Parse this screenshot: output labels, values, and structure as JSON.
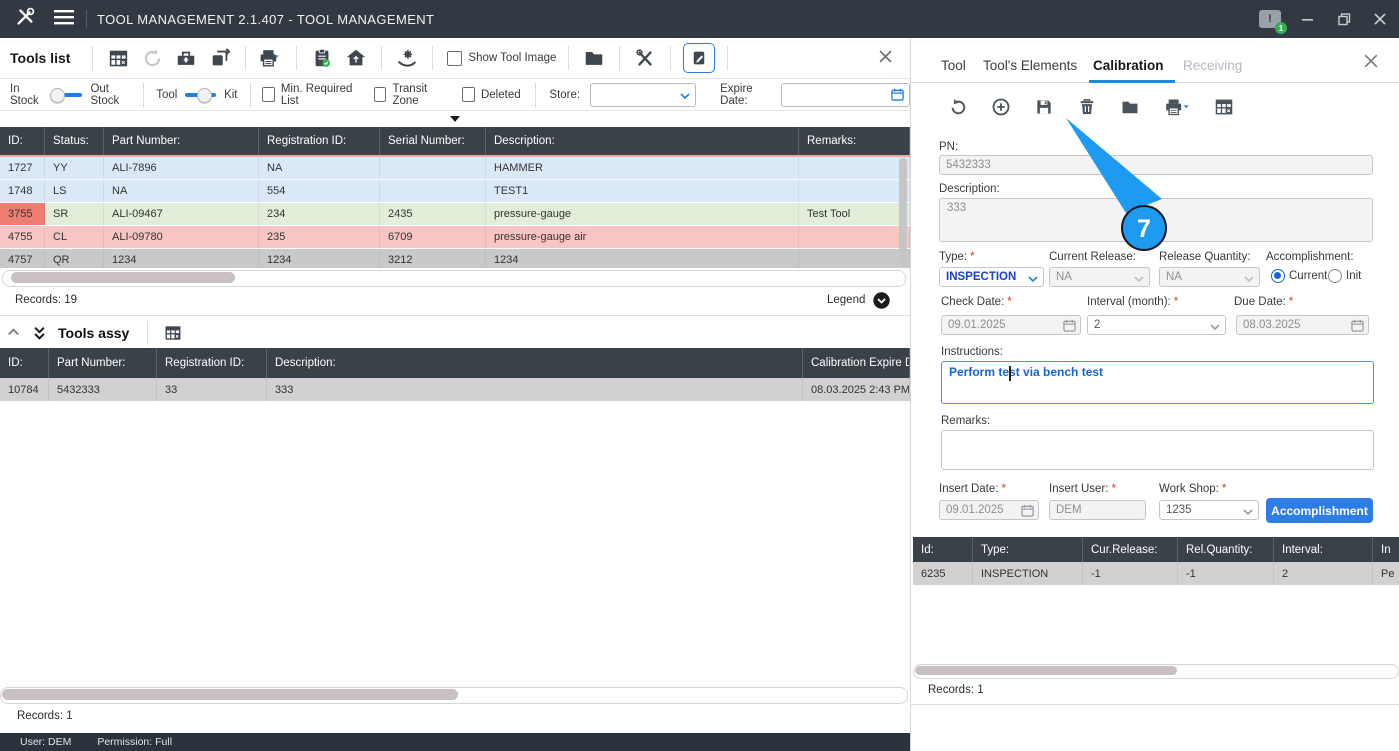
{
  "titlebar": {
    "title": "TOOL MANAGEMENT 2.1.407 - TOOL MANAGEMENT",
    "notification_count": "1"
  },
  "toolbar": {
    "title": "Tools list",
    "show_tool_image_label": "Show Tool Image"
  },
  "filters": {
    "in_stock": "In Stock",
    "out_stock": "Out Stock",
    "tool": "Tool",
    "kit": "Kit",
    "min_required": "Min. Required List",
    "transit_zone": "Transit Zone",
    "deleted": "Deleted",
    "store_label": "Store:",
    "store_value": "",
    "expire_label": "Expire Date:",
    "expire_value": ""
  },
  "tools_table": {
    "headers": [
      "ID:",
      "Status:",
      "Part Number:",
      "Registration ID:",
      "Serial Number:",
      "Description:",
      "Remarks:"
    ],
    "rows": [
      {
        "bg": "#dbe8f8",
        "cells": [
          "1727",
          "YY",
          "ALI-7896",
          "NA",
          "",
          "HAMMER",
          ""
        ]
      },
      {
        "bg": "#dbe8f8",
        "cells": [
          "1748",
          "LS",
          "NA",
          "554",
          "",
          "TEST1",
          ""
        ]
      },
      {
        "bg": "#e1eeda",
        "cells": [
          "3755",
          "SR",
          "ALI-09467",
          "234",
          "2435",
          "pressure-gauge",
          "Test Tool"
        ],
        "cell_bgs": {
          "0": "#ee7e72"
        }
      },
      {
        "bg": "#f7c5c3",
        "cells": [
          "4755",
          "CL",
          "ALI-09780",
          "235",
          "6709",
          "pressure-gauge air",
          ""
        ]
      },
      {
        "bg": "#c9c9c9",
        "cells": [
          "4757",
          "QR",
          "1234",
          "1234",
          "3212",
          "1234",
          ""
        ]
      }
    ],
    "records": "Records: 19",
    "legend_label": "Legend"
  },
  "assy": {
    "title": "Tools assy",
    "table": {
      "headers": [
        "ID:",
        "Part Number:",
        "Registration ID:",
        "Description:",
        "Calibration Expire Da"
      ],
      "rows": [
        {
          "bg": "#d2d0d0",
          "cells": [
            "10784",
            "5432333",
            "33",
            "333",
            "08.03.2025 2:43 PM"
          ]
        }
      ]
    },
    "records": "Records: 1"
  },
  "statusbar": {
    "user": "User: DEM",
    "permission": "Permission: Full"
  },
  "panel": {
    "tabs": {
      "tool": "Tool",
      "elements": "Tool's Elements",
      "calibration": "Calibration",
      "receiving": "Receiving"
    },
    "required_mark": "*",
    "pn_label": "PN:",
    "pn_value": "5432333",
    "desc_label": "Description:",
    "desc_value": "333",
    "type_label": "Type:",
    "type_value": "INSPECTION",
    "cur_release_label": "Current Release:",
    "cur_release_value": "NA",
    "rel_qty_label": "Release Quantity:",
    "rel_qty_value": "NA",
    "accomplishment_label": "Accomplishment:",
    "radio_current": "Current",
    "radio_init": "Init",
    "check_date_label": "Check Date:",
    "check_date_value": "09.01.2025",
    "interval_label": "Interval (month):",
    "interval_value": "2",
    "due_date_label": "Due Date:",
    "due_date_value": "08.03.2025",
    "instructions_label": "Instructions:",
    "instructions_value": "Perform test via bench test",
    "remarks_label": "Remarks:",
    "remarks_value": "",
    "insert_date_label": "Insert Date:",
    "insert_date_value": "09.01.2025",
    "insert_user_label": "Insert User:",
    "insert_user_value": "DEM",
    "work_shop_label": "Work Shop:",
    "work_shop_value": "1235",
    "accomplishment_button": "Accomplishment",
    "cal_table": {
      "headers": [
        "Id:",
        "Type:",
        "Cur.Release:",
        "Rel.Quantity:",
        "Interval:",
        "In"
      ],
      "rows": [
        {
          "bg": "#d2d0d0",
          "cells": [
            "6235",
            "INSPECTION",
            "-1",
            "-1",
            "2",
            "Pe"
          ]
        }
      ]
    },
    "records": "Records: 1",
    "callout_number": "7"
  },
  "colors": {
    "accent_blue": "#1e88e5",
    "callout_blue": "#1e9bf0",
    "button_blue": "#2d7de4",
    "row_blue": "#dbe8f8",
    "row_green": "#e1eeda",
    "row_red": "#f7c5c3",
    "row_selected": "#c9c9c9",
    "status_cell_red": "#ee7e72",
    "header_dark": "#3a4149",
    "titlebar_dark": "#323942"
  }
}
